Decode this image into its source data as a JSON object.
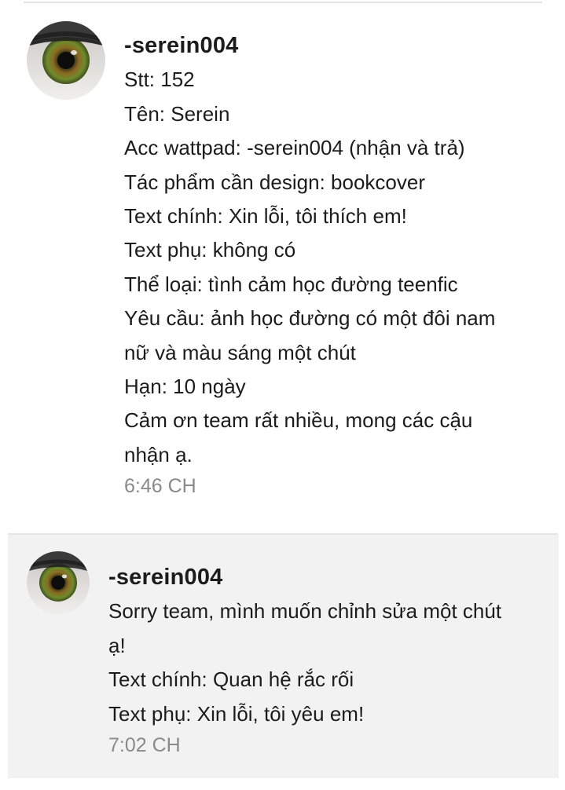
{
  "comments": [
    {
      "username": "-serein004",
      "lines": [
        "Stt: 152",
        "Tên: Serein",
        "Acc wattpad: -serein004 (nhận và trả)",
        "Tác phẩm cần design: bookcover",
        "Text chính: Xin lỗi, tôi thích em!",
        "Text phụ: không có",
        "Thể loại: tình cảm học đường teenfic",
        "Yêu cầu: ảnh học đường có một đôi nam",
        "nữ và màu sáng một chút",
        "Hạn: 10 ngày",
        "Cảm ơn team rất nhiều, mong các cậu",
        "nhận ạ."
      ],
      "time": "6:46 CH",
      "avatar_icon": "eye-avatar-icon"
    },
    {
      "username": "-serein004",
      "lines": [
        "Sorry team, mình muốn chỉnh sửa một chút",
        "ạ!",
        "Text chính: Quan hệ rắc rối",
        "Text phụ: Xin lỗi, tôi yêu em!"
      ],
      "time": "7:02 CH",
      "avatar_icon": "eye-avatar-icon"
    }
  ],
  "colors": {
    "background": "#ffffff",
    "highlight_background": "#f2f2f2",
    "text": "#1c1c1c",
    "timestamp": "#8a8a8a",
    "divider": "#e4e4e4"
  }
}
